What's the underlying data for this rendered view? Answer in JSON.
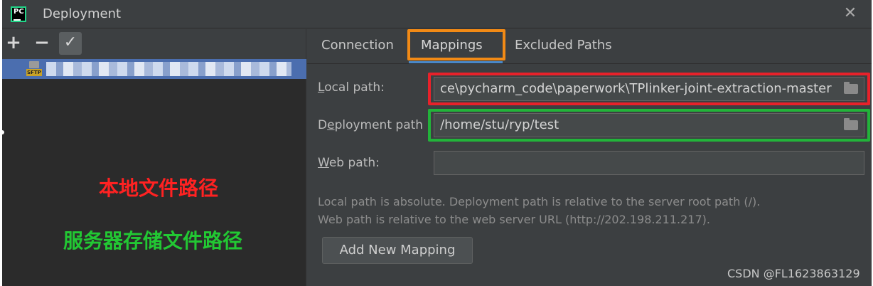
{
  "window": {
    "title": "Deployment",
    "close_glyph": "✕",
    "app_icon_text": "PC"
  },
  "left_toolbar": {
    "add_glyph": "+",
    "remove_glyph": "−",
    "check_glyph": "✓"
  },
  "server_item": {
    "icon_label": "SFTP",
    "name_redacted": true
  },
  "annotations": {
    "local_path_note": "本地文件路径",
    "server_path_note": "服务器存储文件路径"
  },
  "tabs": [
    {
      "label": "Connection",
      "selected": false
    },
    {
      "label": "Mappings",
      "selected": true
    },
    {
      "label": "Excluded Paths",
      "selected": false
    }
  ],
  "fields": {
    "local_path": {
      "label_mnemonic": "L",
      "label_rest": "ocal path:",
      "value": "ce\\pycharm_code\\paperwork\\TPlinker-joint-extraction-master"
    },
    "deployment_path": {
      "label_pre": "D",
      "label_mnemonic": "e",
      "label_rest": "ployment path",
      "value": "/home/stu/ryp/test"
    },
    "web_path": {
      "label_mnemonic": "W",
      "label_rest": "eb path:",
      "value": ""
    }
  },
  "info": {
    "line1": "Local path is absolute. Deployment path is relative to the server root path (/).",
    "line2": "Web path is relative to the web server URL (http://202.198.211.217)."
  },
  "buttons": {
    "add_mapping": "Add New Mapping"
  },
  "watermark": "CSDN @FL1623863129",
  "colors": {
    "highlight_orange": "#f28a15",
    "highlight_red": "#e8212a",
    "highlight_green": "#22b33a",
    "selection_blue": "#4b6eaf"
  }
}
